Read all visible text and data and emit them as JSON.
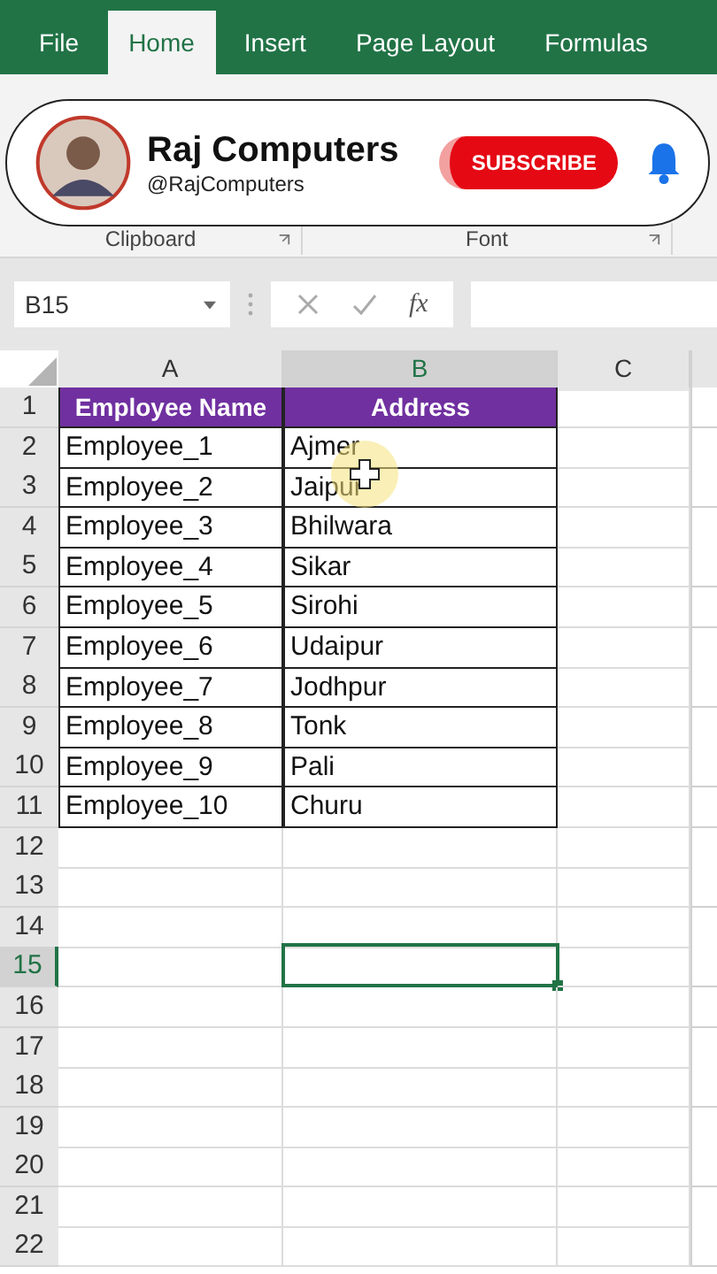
{
  "ribbon_tabs": [
    {
      "label": "File",
      "selected": false
    },
    {
      "label": "Home",
      "selected": true
    },
    {
      "label": "Insert",
      "selected": false
    },
    {
      "label": "Page Layout",
      "selected": false
    },
    {
      "label": "Formulas",
      "selected": false
    }
  ],
  "ribbon": {
    "groups": [
      "Clipboard",
      "Font"
    ]
  },
  "channel_banner": {
    "name": "Raj Computers",
    "handle": "@RajComputers",
    "button": "SUBSCRIBE"
  },
  "name_box": "B15",
  "formula_bar": {
    "function_label": "fx"
  },
  "columns": [
    {
      "label": "A",
      "selected": false
    },
    {
      "label": "B",
      "selected": true
    },
    {
      "label": "C",
      "selected": false
    }
  ],
  "rows": [
    {
      "number": "1",
      "selected": false,
      "kind": "header",
      "cells": [
        "Employee Name",
        "Address"
      ]
    },
    {
      "number": "2",
      "selected": false,
      "kind": "data",
      "cells": [
        "Employee_1",
        "Ajmer"
      ]
    },
    {
      "number": "3",
      "selected": false,
      "kind": "data",
      "cells": [
        "Employee_2",
        "Jaipur"
      ]
    },
    {
      "number": "4",
      "selected": false,
      "kind": "data",
      "cells": [
        "Employee_3",
        "Bhilwara"
      ]
    },
    {
      "number": "5",
      "selected": false,
      "kind": "data",
      "cells": [
        "Employee_4",
        "Sikar"
      ]
    },
    {
      "number": "6",
      "selected": false,
      "kind": "data",
      "cells": [
        "Employee_5",
        "Sirohi"
      ]
    },
    {
      "number": "7",
      "selected": false,
      "kind": "data",
      "cells": [
        "Employee_6",
        "Udaipur"
      ]
    },
    {
      "number": "8",
      "selected": false,
      "kind": "data",
      "cells": [
        "Employee_7",
        "Jodhpur"
      ]
    },
    {
      "number": "9",
      "selected": false,
      "kind": "data",
      "cells": [
        "Employee_8",
        "Tonk"
      ]
    },
    {
      "number": "10",
      "selected": false,
      "kind": "data",
      "cells": [
        "Employee_9",
        "Pali"
      ]
    },
    {
      "number": "11",
      "selected": false,
      "kind": "data",
      "cells": [
        "Employee_10",
        "Churu"
      ]
    },
    {
      "number": "12",
      "selected": false,
      "kind": "empty"
    },
    {
      "number": "13",
      "selected": false,
      "kind": "empty"
    },
    {
      "number": "14",
      "selected": false,
      "kind": "empty"
    },
    {
      "number": "15",
      "selected": true,
      "kind": "empty"
    },
    {
      "number": "16",
      "selected": false,
      "kind": "empty"
    },
    {
      "number": "17",
      "selected": false,
      "kind": "empty"
    },
    {
      "number": "18",
      "selected": false,
      "kind": "empty"
    },
    {
      "number": "19",
      "selected": false,
      "kind": "empty"
    },
    {
      "number": "20",
      "selected": false,
      "kind": "empty"
    },
    {
      "number": "21",
      "selected": false,
      "kind": "empty"
    },
    {
      "number": "22",
      "selected": false,
      "kind": "empty"
    }
  ]
}
